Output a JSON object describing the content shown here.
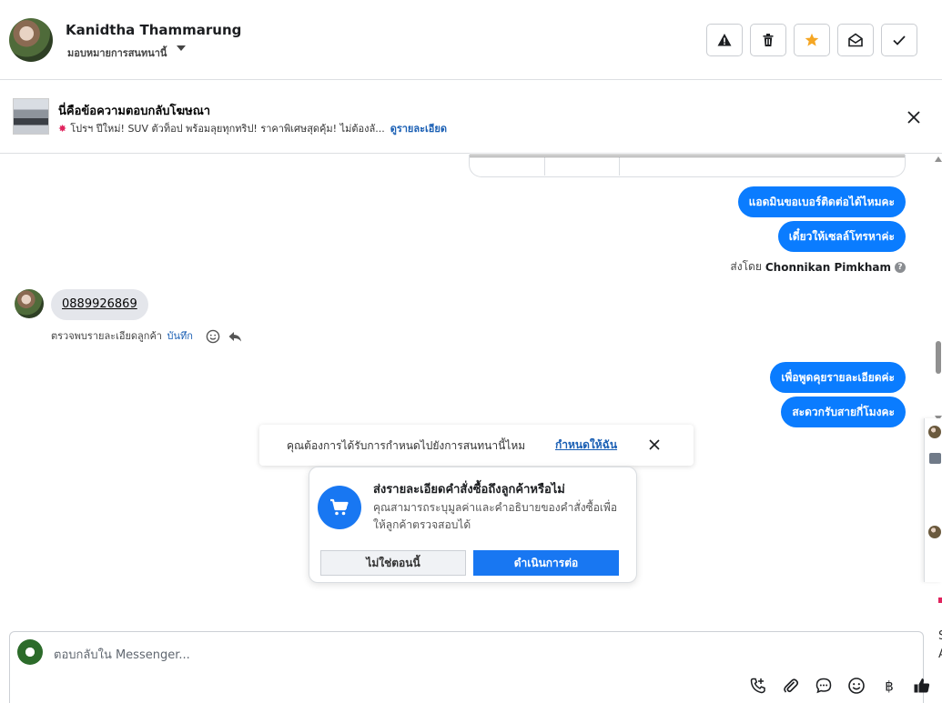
{
  "header": {
    "name": "Kanidtha Thammarung",
    "assign_label": "มอบหมายการสนทนานี้",
    "toolbar": {
      "report_icon": "warning-icon",
      "delete_icon": "trash-icon",
      "star_icon": "star-icon",
      "unread_icon": "envelope-open-icon",
      "done_icon": "check-icon"
    }
  },
  "ad": {
    "title": "นี่คือข้อความตอบกลับโฆษณา",
    "description": "โปรฯ ปีใหม่! SUV ตัวท็อป พร้อมลุยทุกทริป! ราคาพิเศษสุดคุ้ม! ไม่ต้องลั...",
    "link": "ดูรายละเอียด"
  },
  "messages": {
    "outgoing_1": "แอดมินขอเบอร์ติดต่อได้ไหมคะ",
    "outgoing_2": "เดี๋ยวให้เซลล์โทรหาค่ะ",
    "sent_by_prefix": "ส่งโดย",
    "sent_by_name": "Chonnikan Pimkham",
    "incoming_1": "0889926869",
    "detected_text": "ตรวจพบรายละเอียดลูกค้า",
    "detected_save": "บันทึก",
    "outgoing_3": "เพื่อพูดคุยรายละเอียดค่ะ",
    "outgoing_4": "สะดวกรับสายกี่โมงคะ"
  },
  "assign_notice": {
    "text": "คุณต้องการได้รับการกำหนดไปยังการสนทนานี้ไหม",
    "link": "กำหนดให้ฉัน"
  },
  "order_card": {
    "title": "ส่งรายละเอียดคำสั่งซื้อถึงลูกค้าหรือไม่",
    "description": "คุณสามารถระบุมูลค่าและคำอธิบายของคำสั่งซื้อเพื่อให้ลูกค้าตรวจสอบได้",
    "decline": "ไม่ใช่ตอนนี้",
    "accept": "ดำเนินการต่อ"
  },
  "composer": {
    "placeholder": "ตอบกลับใน Messenger...",
    "tools": [
      "call-icon",
      "attachment-icon",
      "saved-reply-icon",
      "emoji-icon",
      "baht-icon",
      "like-icon"
    ]
  },
  "side_panel": {
    "letters": [
      "S",
      "A"
    ]
  },
  "colors": {
    "accent": "#1877f2",
    "bubble_out": "#0a7cff",
    "bubble_in": "#e4e6eb",
    "star": "#f5a623"
  }
}
